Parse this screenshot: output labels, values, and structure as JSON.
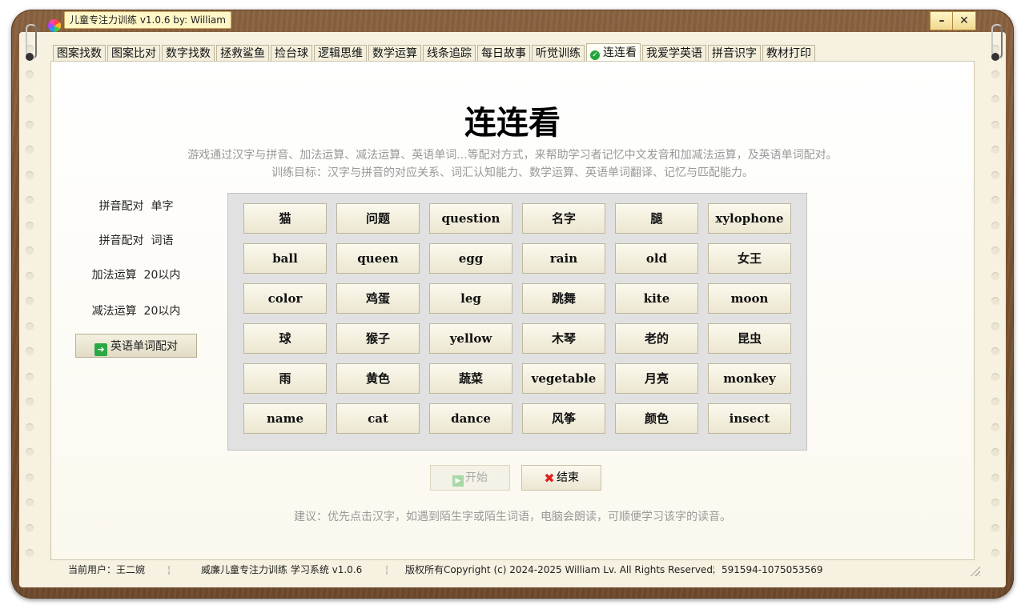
{
  "window": {
    "title": "儿童专注力训练 v1.0.6 by: William",
    "minimize": "–",
    "close": "✕"
  },
  "tabs": [
    {
      "label": "图案找数"
    },
    {
      "label": "图案比对"
    },
    {
      "label": "数字找数"
    },
    {
      "label": "拯救鲨鱼"
    },
    {
      "label": "捡台球"
    },
    {
      "label": "逻辑思维"
    },
    {
      "label": "数学运算"
    },
    {
      "label": "线条追踪"
    },
    {
      "label": "每日故事"
    },
    {
      "label": "听觉训练"
    },
    {
      "label": "连连看",
      "active": true
    },
    {
      "label": "我爱学英语"
    },
    {
      "label": "拼音识字"
    },
    {
      "label": "教材打印"
    }
  ],
  "main": {
    "title": "连连看",
    "description": "游戏通过汉字与拼音、加法运算、减法运算、英语单词...等配对方式，来帮助学习者记忆中文发音和加减法运算，及英语单词配对。",
    "goal": "训练目标：汉字与拼音的对应关系、词汇认知能力、数学运算、英语单词翻译、记忆与匹配能力。"
  },
  "modes": [
    {
      "label": "拼音配对  单字"
    },
    {
      "label": "拼音配对  词语"
    },
    {
      "label": "加法运算  20以内"
    },
    {
      "label": "减法运算  20以内"
    },
    {
      "label": "英语单词配对",
      "selected": true
    }
  ],
  "grid": [
    [
      "猫",
      "问题",
      "question",
      "名字",
      "腿",
      "xylophone"
    ],
    [
      "ball",
      "queen",
      "egg",
      "rain",
      "old",
      "女王"
    ],
    [
      "color",
      "鸡蛋",
      "leg",
      "跳舞",
      "kite",
      "moon"
    ],
    [
      "球",
      "猴子",
      "yellow",
      "木琴",
      "老的",
      "昆虫"
    ],
    [
      "雨",
      "黄色",
      "蔬菜",
      "vegetable",
      "月亮",
      "monkey"
    ],
    [
      "name",
      "cat",
      "dance",
      "风筝",
      "颜色",
      "insect"
    ]
  ],
  "buttons": {
    "start": "开始",
    "end": "结束"
  },
  "tip": "建议：优先点击汉字，如遇到陌生字或陌生词语，电脑会朗读，可顺便学习该字的读音。",
  "status": {
    "user": "当前用户：王二婉",
    "system": "威廉儿童专注力训练 学习系统 v1.0.6",
    "copyright": "版权所有Copyright (c) 2024-2025 William Lv. All Rights Reserved.",
    "contact": "591594-1075053569"
  },
  "colors": {
    "frame": "#7a5434",
    "paper": "#f6f1e0",
    "active_check": "#27a53c",
    "close_x": "#e02020"
  }
}
